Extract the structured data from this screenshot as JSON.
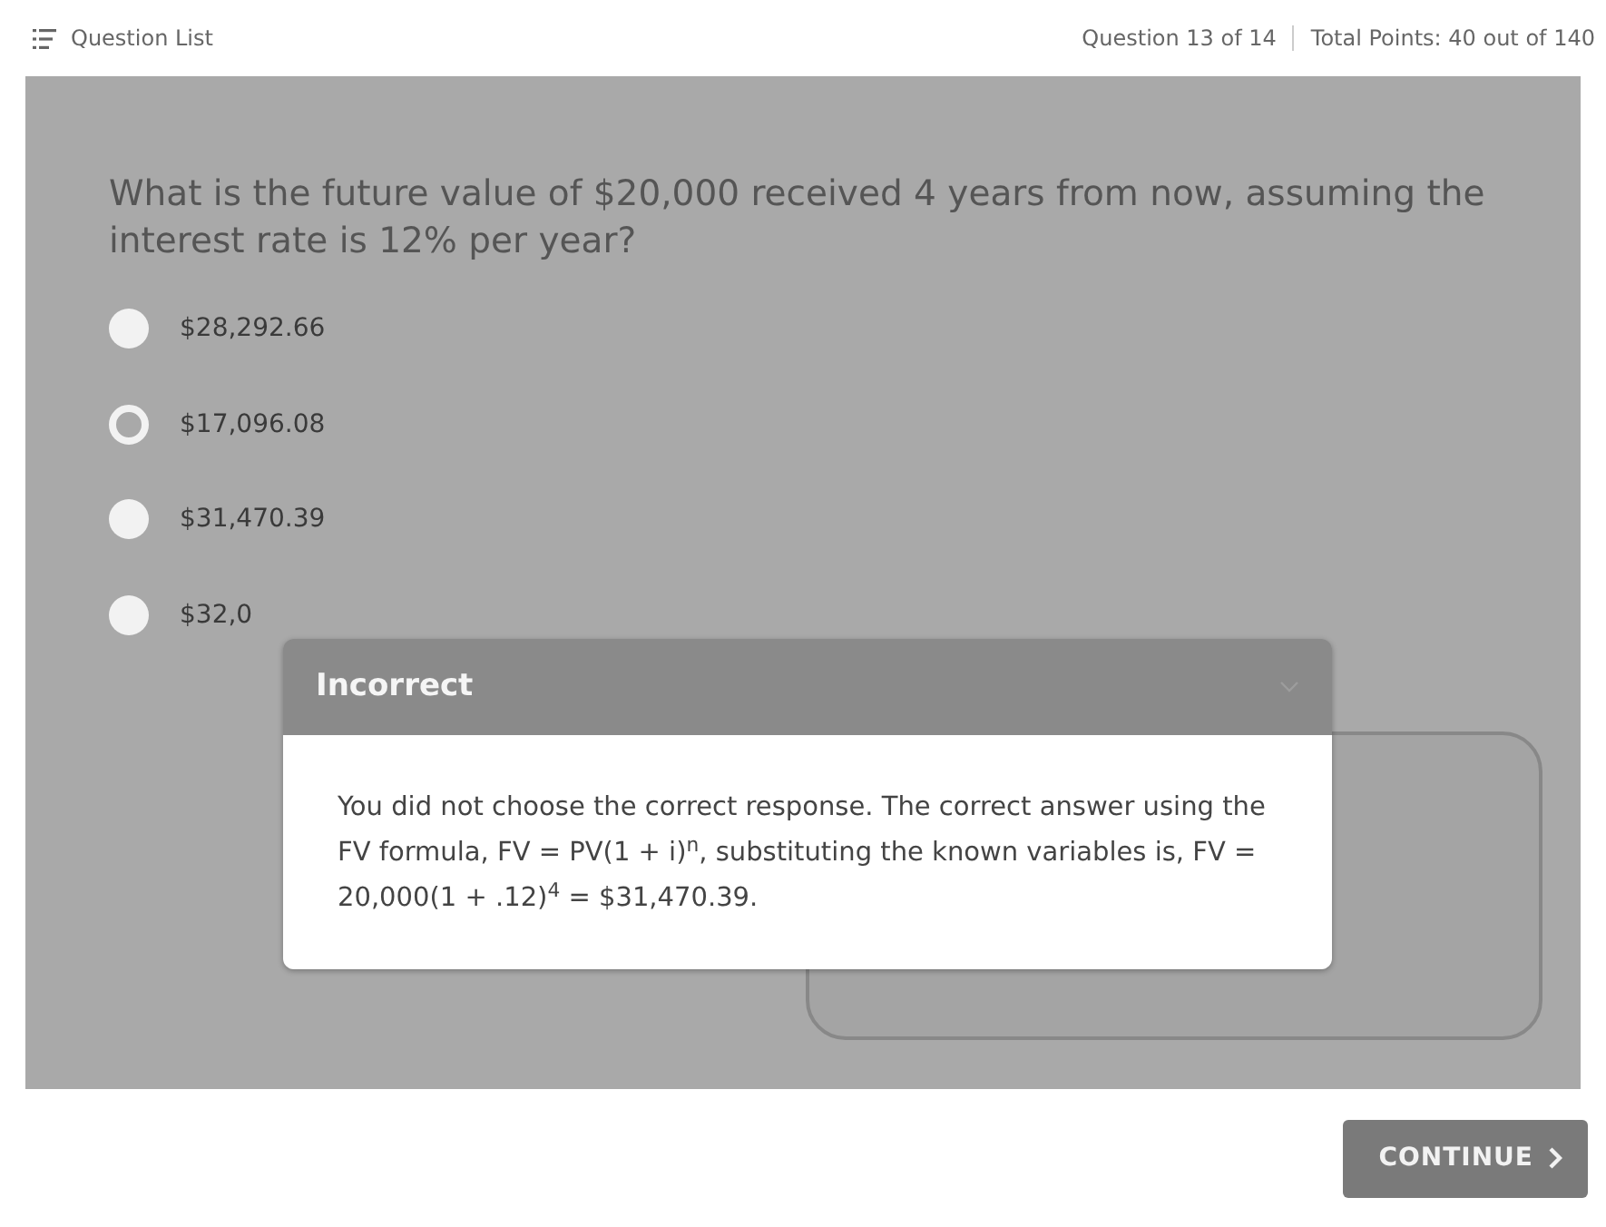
{
  "header": {
    "question_list": "Question List",
    "progress": "Question 13 of 14",
    "points": "Total Points: 40 out of 140"
  },
  "question": "What is the future value of $20,000 received 4 years from now, assuming the interest rate is 12% per year?",
  "options": [
    {
      "label": "$28,292.66",
      "selected": false
    },
    {
      "label": "$17,096.08",
      "selected": true
    },
    {
      "label": "$31,470.39",
      "selected": false
    },
    {
      "label": "$32,0",
      "selected": false
    }
  ],
  "feedback": {
    "title": "Incorrect",
    "message": "You did not choose the correct response. The correct answer using the FV formula, FV = PV(1 + i)$^{n}$, substituting the known variables is, FV = 20,000(1 + .12)$^{4}$ = $31,470.39."
  },
  "continue_button": "CONTINUE"
}
